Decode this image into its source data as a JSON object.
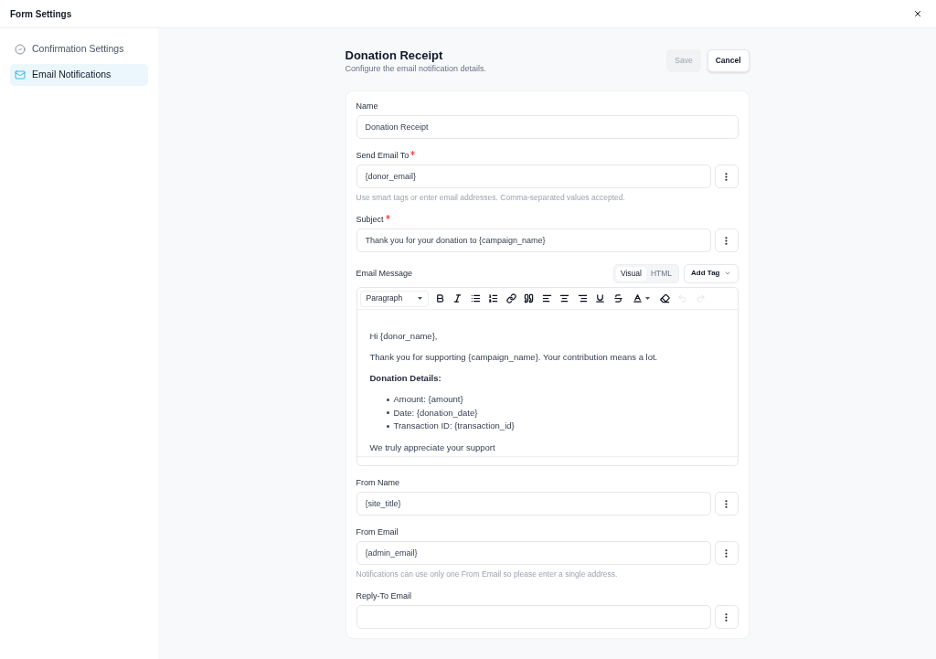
{
  "window": {
    "title": "Form Settings"
  },
  "sidebar": {
    "items": [
      {
        "kind": "check",
        "label": "Confirmation Settings",
        "selected": false
      },
      {
        "kind": "mail",
        "label": "Email Notifications",
        "selected": true
      }
    ]
  },
  "header": {
    "title": "Donation Receipt",
    "subtitle": "Configure the email notification details.",
    "buttons": [
      {
        "kind": "primary",
        "label": "Save",
        "disabled": true
      },
      {
        "kind": "secondary",
        "label": "Cancel",
        "disabled": false
      }
    ]
  },
  "fields": [
    {
      "kind": "input",
      "label": "Name",
      "required": false,
      "value": "Donation Receipt"
    },
    {
      "kind": "input_menu",
      "label": "Send Email To",
      "required": true,
      "value": "{donor_email}",
      "help": "Use smart tags or enter email addresses. Comma-separated values accepted."
    },
    {
      "kind": "input_menu",
      "label": "Subject",
      "required": true,
      "value": "Thank you for your donation to {campaign_name}"
    },
    {
      "kind": "editor",
      "label": "Email Message",
      "required": false,
      "modes": [
        {
          "label": "Visual",
          "selected": true
        },
        {
          "label": "HTML",
          "selected": false
        }
      ],
      "add_tag": "Add Tag",
      "toolbar": {
        "format": "Paragraph",
        "tools": [
          {
            "kind": "bold",
            "disabled": false
          },
          {
            "kind": "italic",
            "disabled": false
          },
          {
            "kind": "bullet_list",
            "disabled": false
          },
          {
            "kind": "numbered_list",
            "disabled": false
          },
          {
            "kind": "link",
            "disabled": false
          },
          {
            "kind": "quote",
            "disabled": false
          },
          {
            "kind": "align_left",
            "disabled": false
          },
          {
            "kind": "align_center",
            "disabled": false
          },
          {
            "kind": "align_right",
            "disabled": false
          },
          {
            "kind": "underline",
            "disabled": false
          },
          {
            "kind": "strikethrough",
            "disabled": false
          },
          {
            "kind": "text_color",
            "disabled": false
          },
          {
            "kind": "clear_format",
            "disabled": false
          },
          {
            "kind": "undo",
            "disabled": true
          },
          {
            "kind": "redo",
            "disabled": true
          }
        ]
      },
      "content": [
        {
          "kind": "paragraph",
          "text": "Hi {donor_name},"
        },
        {
          "kind": "paragraph",
          "text": "Thank you for supporting {campaign_name}. Your contribution means a lot."
        },
        {
          "kind": "heading",
          "text": "Donation Details:"
        },
        {
          "kind": "list",
          "items": [
            "Amount: {amount}",
            "Date: {donation_date}",
            "Transaction ID: {transaction_id}"
          ]
        },
        {
          "kind": "paragraph",
          "text": "We truly appreciate your support"
        }
      ]
    },
    {
      "kind": "input_menu",
      "label": "From Name",
      "required": false,
      "value": "{site_title}"
    },
    {
      "kind": "input_menu",
      "label": "From Email",
      "required": false,
      "value": "{admin_email}",
      "help": "Notifications can use only one From Email so please enter a single address."
    },
    {
      "kind": "input_menu",
      "label": "Reply-To Email",
      "required": false
    }
  ]
}
